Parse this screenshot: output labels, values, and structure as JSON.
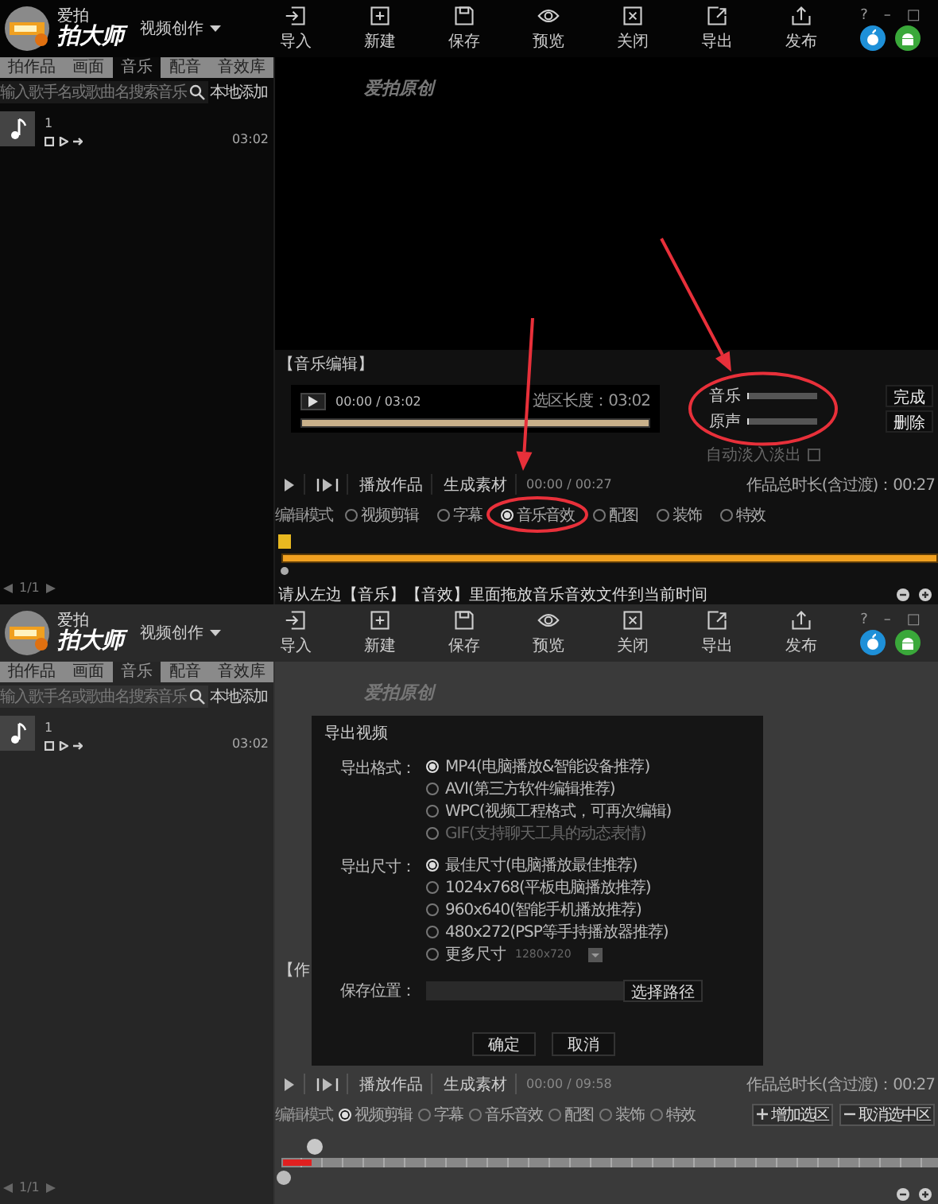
{
  "screens": [
    {
      "header": {
        "brand_small": "爱拍",
        "brand": "拍大师",
        "mode_menu": "视频创作",
        "window_buttons": [
          "?",
          "–",
          "□"
        ],
        "toolbar": [
          {
            "label": "导入",
            "kind": "import"
          },
          {
            "label": "新建",
            "kind": "new"
          },
          {
            "label": "保存",
            "kind": "save"
          },
          {
            "label": "预览",
            "kind": "preview"
          },
          {
            "label": "关闭",
            "kind": "close"
          },
          {
            "label": "导出",
            "kind": "export"
          },
          {
            "label": "发布",
            "kind": "publish"
          }
        ]
      },
      "sidebar": {
        "tabs": [
          {
            "label": "拍作品",
            "selected": false
          },
          {
            "label": "画面",
            "selected": false
          },
          {
            "label": "音乐",
            "selected": true
          },
          {
            "label": "配音",
            "selected": false
          },
          {
            "label": "音效库",
            "selected": false
          }
        ],
        "search": {
          "placeholder": "输入歌手名或歌曲名搜索音乐",
          "button": "本地添加"
        },
        "items": [
          {
            "title": "1",
            "duration": "03:02"
          }
        ],
        "pager": "1/1"
      },
      "preview": {
        "watermark": "爱拍原创"
      },
      "music_editor": {
        "title": "【音乐编辑】",
        "time": "00:00 / 03:02",
        "selection": "选区长度：03:02",
        "level": 1,
        "sliders": [
          {
            "label": "音乐",
            "level": 0.02
          },
          {
            "label": "原声",
            "level": 0.02
          }
        ],
        "fade": {
          "label": "自动淡入淡出",
          "checked": false
        },
        "buttons": [
          "完成",
          "删除"
        ]
      },
      "controls": {
        "buttons": [
          "播放作品",
          "生成素材"
        ],
        "time": "00:00 / 00:27",
        "total": "作品总时长(含过渡)：00:27"
      },
      "modes": {
        "label": "编辑模式",
        "options": [
          {
            "label": "视频剪辑",
            "selected": false
          },
          {
            "label": "字幕",
            "selected": false
          },
          {
            "label": "音乐音效",
            "selected": true
          },
          {
            "label": "配图",
            "selected": false
          },
          {
            "label": "装饰",
            "selected": false
          },
          {
            "label": "特效",
            "selected": false
          }
        ]
      },
      "timeline": {
        "kind": "music",
        "level": 1
      },
      "status": "请从左边【音乐】【音效】里面拖放音乐音效文件到当前时间",
      "annotations": [
        {
          "kind": "arrow"
        },
        {
          "kind": "arrow"
        },
        {
          "kind": "ellipse"
        },
        {
          "kind": "ellipse"
        }
      ]
    },
    {
      "header": {
        "brand_small": "爱拍",
        "brand": "拍大师",
        "mode_menu": "视频创作",
        "window_buttons": [
          "?",
          "–",
          "□"
        ],
        "toolbar": [
          {
            "label": "导入",
            "kind": "import"
          },
          {
            "label": "新建",
            "kind": "new"
          },
          {
            "label": "保存",
            "kind": "save"
          },
          {
            "label": "预览",
            "kind": "preview"
          },
          {
            "label": "关闭",
            "kind": "close"
          },
          {
            "label": "导出",
            "kind": "export"
          },
          {
            "label": "发布",
            "kind": "publish"
          }
        ]
      },
      "sidebar": {
        "tabs": [
          {
            "label": "拍作品",
            "selected": false
          },
          {
            "label": "画面",
            "selected": false
          },
          {
            "label": "音乐",
            "selected": true
          },
          {
            "label": "配音",
            "selected": false
          },
          {
            "label": "音效库",
            "selected": false
          }
        ],
        "search": {
          "placeholder": "输入歌手名或歌曲名搜索音乐",
          "button": "本地添加"
        },
        "items": [
          {
            "title": "1",
            "duration": "03:02"
          }
        ],
        "pager": "1/1"
      },
      "preview": {
        "watermark": "爱拍原创"
      },
      "behind_text": "【作",
      "controls": {
        "buttons": [
          "播放作品",
          "生成素材"
        ],
        "time": "00:00 / 09:58",
        "total": "作品总时长(含过渡)：00:27"
      },
      "modes": {
        "label": "编辑模式",
        "options": [
          {
            "label": "视频剪辑",
            "selected": true
          },
          {
            "label": "字幕",
            "selected": false
          },
          {
            "label": "音乐音效",
            "selected": false
          },
          {
            "label": "配图",
            "selected": false
          },
          {
            "label": "装饰",
            "selected": false
          },
          {
            "label": "特效",
            "selected": false
          }
        ],
        "actions": [
          {
            "label": "增加选区",
            "kind": "add"
          },
          {
            "label": "取消选中区",
            "kind": "remove"
          }
        ]
      },
      "timeline": {
        "kind": "video",
        "level": 0.045
      },
      "dialog": {
        "title": "导出视频",
        "format_label": "导出格式：",
        "formats": [
          {
            "label": "MP4(电脑播放&智能设备推荐)",
            "selected": true,
            "disabled": false
          },
          {
            "label": "AVI(第三方软件编辑推荐)",
            "selected": false,
            "disabled": false
          },
          {
            "label": "WPC(视频工程格式，可再次编辑)",
            "selected": false,
            "disabled": false
          },
          {
            "label": "GIF(支持聊天工具的动态表情)",
            "selected": false,
            "disabled": true
          }
        ],
        "size_label": "导出尺寸：",
        "sizes": [
          {
            "label": "最佳尺寸(电脑播放最佳推荐)",
            "selected": true
          },
          {
            "label": "1024x768(平板电脑播放推荐)",
            "selected": false
          },
          {
            "label": "960x640(智能手机播放推荐)",
            "selected": false
          },
          {
            "label": "480x272(PSP等手持播放器推荐)",
            "selected": false
          },
          {
            "label": "更多尺寸",
            "selected": false,
            "value": "1280x720"
          }
        ],
        "save_label": "保存位置：",
        "path_button": "选择路径",
        "buttons": [
          "确定",
          "取消"
        ]
      }
    }
  ]
}
